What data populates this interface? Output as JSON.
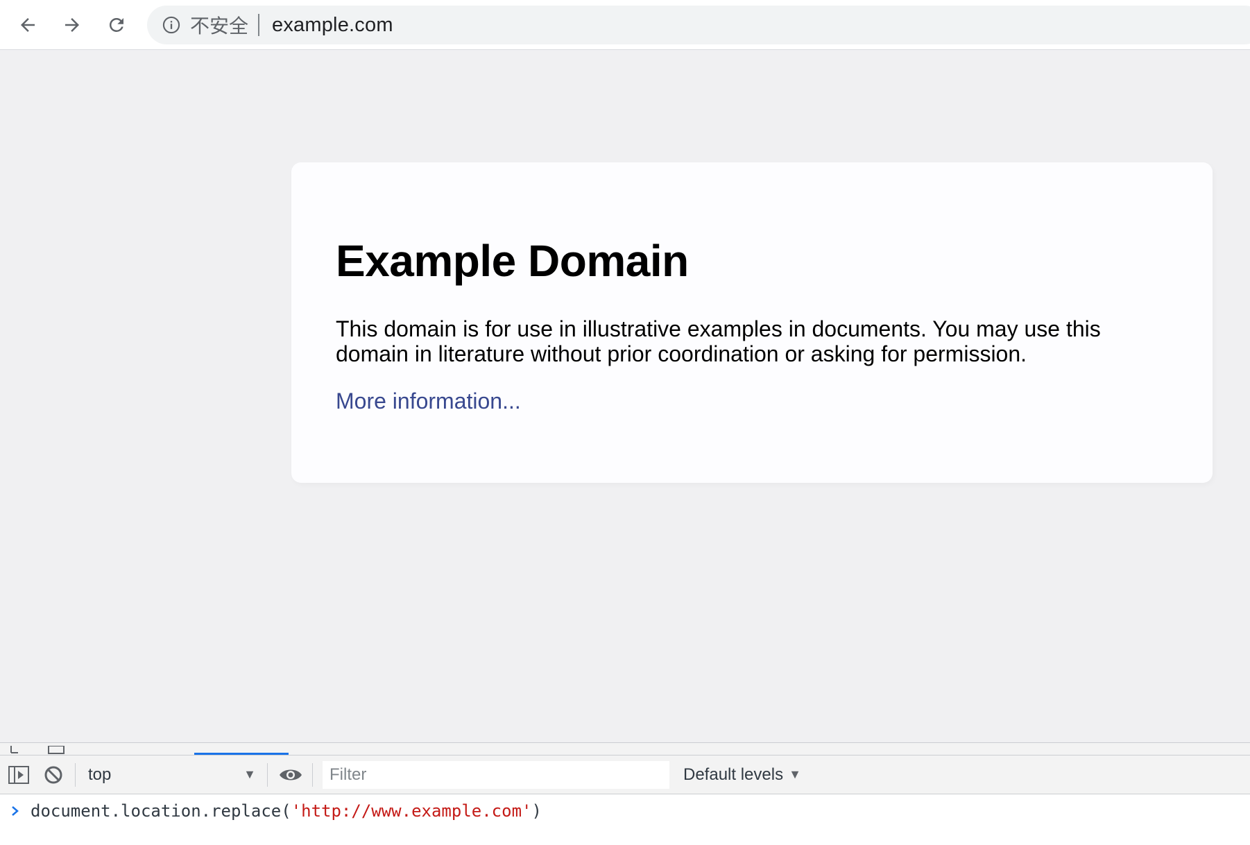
{
  "browser": {
    "security_label": "不安全",
    "url": "example.com",
    "nav": {
      "back_icon": "arrow-left-icon",
      "forward_icon": "arrow-right-icon",
      "reload_icon": "reload-icon"
    }
  },
  "page": {
    "title": "Example Domain",
    "description": "This domain is for use in illustrative examples in documents. You may use this domain in literature without prior coordination or asking for permission.",
    "link_text": "More information..."
  },
  "devtools": {
    "context": "top",
    "filter_placeholder": "Filter",
    "levels": "Default levels",
    "console_input": {
      "prefix": "document.location.replace(",
      "string": "'http://www.example.com'",
      "suffix": ")"
    }
  },
  "colors": {
    "link": "#38488f",
    "page_bg": "#f0f0f2",
    "card_bg": "#fdfdff",
    "console_string": "#c41a16",
    "prompt": "#1a73e8"
  }
}
